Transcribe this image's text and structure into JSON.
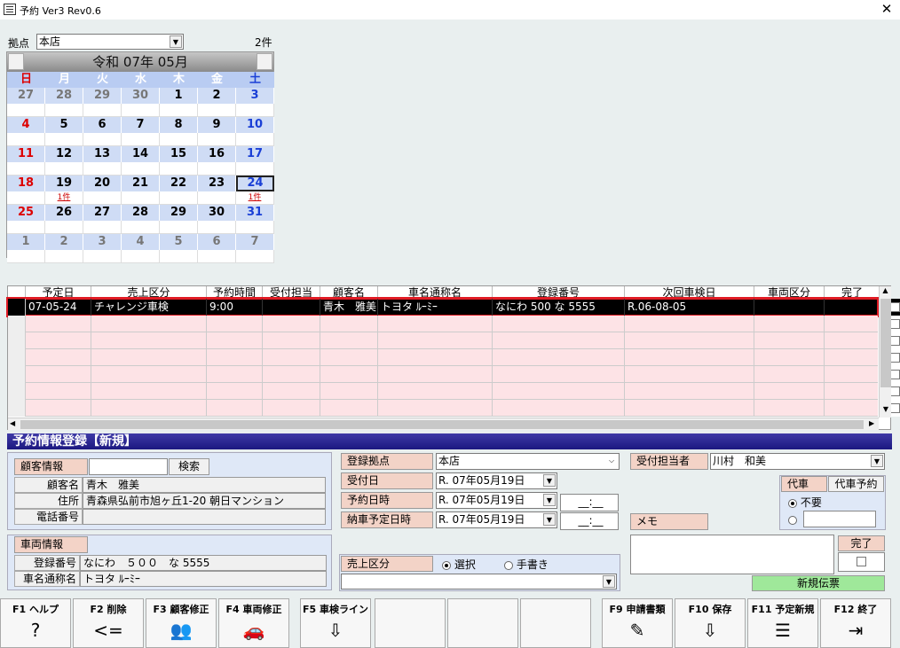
{
  "window": {
    "title": "予約 Ver3 Rev0.6",
    "close": "✕"
  },
  "location": {
    "label": "拠点",
    "value": "本店",
    "count": "2件"
  },
  "calendar": {
    "title": "令和 07年 05月",
    "weekdays": [
      "日",
      "月",
      "火",
      "水",
      "木",
      "金",
      "土"
    ],
    "weeks": [
      [
        {
          "d": "27",
          "c": "grey",
          "s": ""
        },
        {
          "d": "28",
          "c": "grey",
          "s": ""
        },
        {
          "d": "29",
          "c": "grey",
          "s": ""
        },
        {
          "d": "30",
          "c": "grey",
          "s": ""
        },
        {
          "d": "1",
          "c": "",
          "s": ""
        },
        {
          "d": "2",
          "c": "",
          "s": ""
        },
        {
          "d": "3",
          "c": "sat",
          "s": ""
        }
      ],
      [
        {
          "d": "4",
          "c": "sun",
          "s": ""
        },
        {
          "d": "5",
          "c": "",
          "s": ""
        },
        {
          "d": "6",
          "c": "",
          "s": ""
        },
        {
          "d": "7",
          "c": "",
          "s": ""
        },
        {
          "d": "8",
          "c": "",
          "s": ""
        },
        {
          "d": "9",
          "c": "",
          "s": ""
        },
        {
          "d": "10",
          "c": "sat",
          "s": ""
        }
      ],
      [
        {
          "d": "11",
          "c": "sun",
          "s": ""
        },
        {
          "d": "12",
          "c": "",
          "s": ""
        },
        {
          "d": "13",
          "c": "",
          "s": ""
        },
        {
          "d": "14",
          "c": "",
          "s": ""
        },
        {
          "d": "15",
          "c": "",
          "s": ""
        },
        {
          "d": "16",
          "c": "",
          "s": ""
        },
        {
          "d": "17",
          "c": "sat",
          "s": ""
        }
      ],
      [
        {
          "d": "18",
          "c": "sun",
          "s": ""
        },
        {
          "d": "19",
          "c": "",
          "s": "1件"
        },
        {
          "d": "20",
          "c": "",
          "s": ""
        },
        {
          "d": "21",
          "c": "",
          "s": ""
        },
        {
          "d": "22",
          "c": "",
          "s": ""
        },
        {
          "d": "23",
          "c": "",
          "s": ""
        },
        {
          "d": "24",
          "c": "sat",
          "s": "1件"
        }
      ],
      [
        {
          "d": "25",
          "c": "sun",
          "s": ""
        },
        {
          "d": "26",
          "c": "",
          "s": ""
        },
        {
          "d": "27",
          "c": "",
          "s": ""
        },
        {
          "d": "28",
          "c": "",
          "s": ""
        },
        {
          "d": "29",
          "c": "",
          "s": ""
        },
        {
          "d": "30",
          "c": "",
          "s": ""
        },
        {
          "d": "31",
          "c": "sat",
          "s": ""
        }
      ],
      [
        {
          "d": "1",
          "c": "grey",
          "s": ""
        },
        {
          "d": "2",
          "c": "grey",
          "s": ""
        },
        {
          "d": "3",
          "c": "grey",
          "s": ""
        },
        {
          "d": "4",
          "c": "grey",
          "s": ""
        },
        {
          "d": "5",
          "c": "grey",
          "s": ""
        },
        {
          "d": "6",
          "c": "grey",
          "s": ""
        },
        {
          "d": "7",
          "c": "grey",
          "s": ""
        }
      ]
    ]
  },
  "grid": {
    "columns": [
      "予定日",
      "売上区分",
      "予約時間",
      "受付担当",
      "顧客名",
      "車名通称名",
      "登録番号",
      "次回車検日",
      "車両区分",
      "完了"
    ],
    "rows": [
      [
        "07-05-24",
        "チャレンジ車検",
        "9:00",
        "",
        "青木　雅美",
        "トヨタ ﾙｰﾐｰ",
        "なにわ 500 な 5555",
        "R.06-08-05",
        ""
      ]
    ]
  },
  "form": {
    "section_title": "予約情報登録【新規】",
    "customer": {
      "header": "顧客情報",
      "search": "検索",
      "name_label": "顧客名",
      "name": "青木　雅美",
      "addr_label": "住所",
      "addr": "青森県弘前市旭ヶ丘1-20 朝日マンション",
      "tel_label": "電話番号",
      "tel": ""
    },
    "vehicle": {
      "header": "車両情報",
      "reg_label": "登録番号",
      "reg": "なにわ　５００　な 5555",
      "model_label": "車名通称名",
      "model": "トヨタ ﾙｰﾐｰ"
    },
    "reg_site": {
      "label": "登録拠点",
      "value": "本店"
    },
    "recv_date": {
      "label": "受付日",
      "value": "R. 07年05月19日"
    },
    "resv_dt": {
      "label": "予約日時",
      "value": "R. 07年05月19日",
      "time": "__:__"
    },
    "deliv_dt": {
      "label": "納車予定日時",
      "value": "R. 07年05月19日",
      "time": "__:__"
    },
    "sales": {
      "label": "売上区分",
      "opt1": "選択",
      "opt2": "手書き",
      "value": ""
    },
    "staff": {
      "label": "受付担当者",
      "value": "川村　和美"
    },
    "daisha": {
      "label": "代車",
      "reserve": "代車予約",
      "opt1": "不要"
    },
    "memo": {
      "label": "メモ"
    },
    "done": {
      "label": "完了"
    },
    "new_slip": "新規伝票"
  },
  "fkeys": [
    {
      "label": "F1 ヘルプ",
      "icon": "?"
    },
    {
      "label": "F2 削除",
      "icon": "<="
    },
    {
      "label": "F3 顧客修正",
      "icon": "👥"
    },
    {
      "label": "F4 車両修正",
      "icon": "🚗"
    },
    {
      "label": "F5 車検ライン",
      "icon": "⇩"
    },
    {
      "label": "",
      "icon": ""
    },
    {
      "label": "",
      "icon": ""
    },
    {
      "label": "",
      "icon": ""
    },
    {
      "label": "F9 申請書類",
      "icon": "✎"
    },
    {
      "label": "F10 保存",
      "icon": "⇩"
    },
    {
      "label": "F11 予定新規",
      "icon": "☰"
    },
    {
      "label": "F12 終了",
      "icon": "⇥"
    }
  ]
}
